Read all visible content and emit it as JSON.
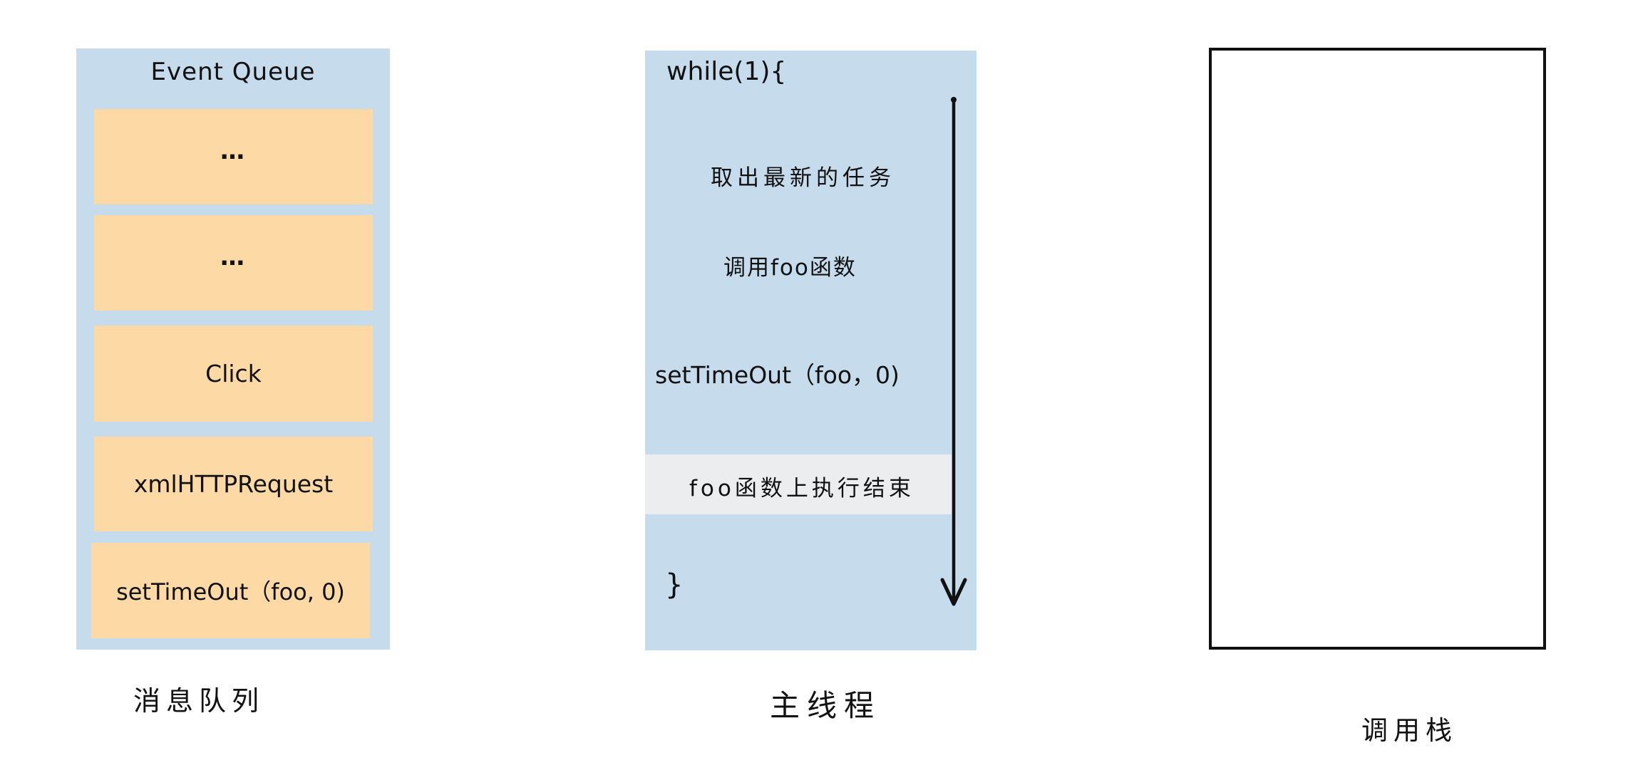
{
  "colors": {
    "panel_blue": "#c6dcec",
    "queue_item_orange": "#fdd9a5",
    "highlight_gray": "#ebedef",
    "ink": "#111111",
    "background": "#ffffff"
  },
  "event_queue": {
    "title": "Event Queue",
    "items": [
      {
        "label": "…"
      },
      {
        "label": "…"
      },
      {
        "label": "Click"
      },
      {
        "label": "xmlHTTPRequest"
      },
      {
        "label": "setTimeOut（foo, 0)"
      }
    ],
    "caption": "消息队列"
  },
  "main_thread": {
    "loop_open": "while(1){",
    "steps": [
      {
        "label": "取出最新的任务",
        "highlighted": false
      },
      {
        "label": "调用foo函数",
        "highlighted": false
      },
      {
        "label": "setTimeOut（foo，0)",
        "highlighted": false
      },
      {
        "label": "foo函数上执行结束",
        "highlighted": true
      }
    ],
    "loop_close": "}",
    "flow_arrow": "down-arrow",
    "caption": "主线程"
  },
  "call_stack": {
    "frames": [],
    "caption": "调用栈"
  }
}
